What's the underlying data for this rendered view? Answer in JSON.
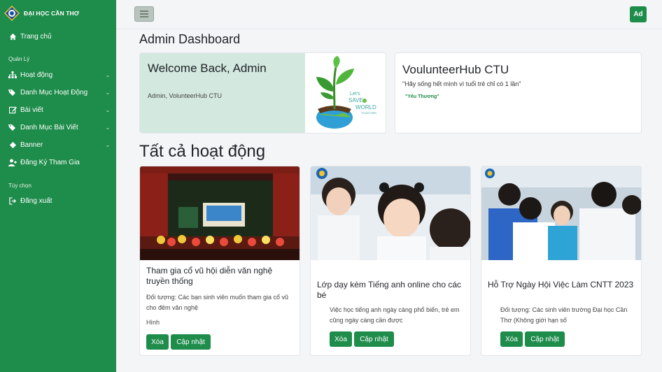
{
  "brand": {
    "name": "ĐẠI HỌC CẦN THƠ"
  },
  "sidebar": {
    "home": "Trang chủ",
    "section_manage": "Quản Lý",
    "items": [
      {
        "label": "Hoạt động",
        "icon": "sitemap-icon"
      },
      {
        "label": "Danh Mục Hoạt Động",
        "icon": "tags-icon"
      },
      {
        "label": "Bài viết",
        "icon": "edit-icon"
      },
      {
        "label": "Danh Mục Bài Viết",
        "icon": "tags-icon"
      },
      {
        "label": "Banner",
        "icon": "diamond-icon"
      },
      {
        "label": "Đăng Ký Tham Gia",
        "icon": "user-plus-icon"
      }
    ],
    "section_options": "Tùy chọn",
    "logout": "Đăng xuất"
  },
  "header": {
    "avatar": "Ad"
  },
  "page_title": "Admin Dashboard",
  "welcome": {
    "title": "Welcome Back, Admin",
    "subtitle": "Admin, VolunteerHub CTU"
  },
  "hub": {
    "title": "VoulunteerHub CTU",
    "quote": "\"Hãy sống hết mình vì tuổi trẻ chỉ có 1 lần\"",
    "tag": "\"Yêu Thương\""
  },
  "activities_title": "Tất cả hoạt động",
  "activities": [
    {
      "title": "Tham gia cổ vũ hội diễn văn nghệ truyền thống",
      "desc": "Đối tượng: Các bạn sinh viên muốn tham gia cổ vũ cho đêm văn nghệ",
      "extra": "Hình",
      "delete": "Xóa",
      "update": "Cập nhật"
    },
    {
      "title": "Lớp dạy kèm Tiếng anh online cho các bé",
      "desc": "Việc học tiếng anh ngày càng phổ biến, trẻ em cũng ngày càng cần được",
      "delete": "Xóa",
      "update": "Cập nhật"
    },
    {
      "title": "Hỗ Trợ Ngày Hội Việc Làm CNTT 2023",
      "desc": "Đối tượng: Các sinh viên trường Đại học Cần Thơ (Không giới hạn số",
      "delete": "Xóa",
      "update": "Cập nhật"
    }
  ],
  "colors": {
    "primary": "#1e8c4a",
    "welcome_bg": "#d3e8df",
    "page_bg": "#f4f5f7"
  }
}
